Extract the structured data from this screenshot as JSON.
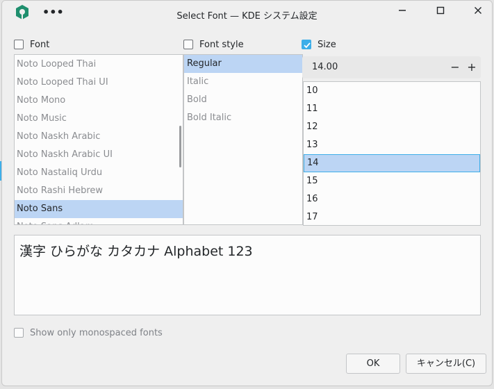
{
  "window": {
    "title": "Select Font — KDE システム設定",
    "menu_glyph": "•••",
    "minimize": "—",
    "maximize": "☐",
    "close": "✕"
  },
  "columns": {
    "font": {
      "label": "Font",
      "checked": false
    },
    "style": {
      "label": "Font style",
      "checked": false
    },
    "size": {
      "label": "Size",
      "checked": true
    }
  },
  "font_list": {
    "items": [
      "Noto Looped Thai",
      "Noto Looped Thai UI",
      "Noto Mono",
      "Noto Music",
      "Noto Naskh Arabic",
      "Noto Naskh Arabic UI",
      "Noto Nastaliq Urdu",
      "Noto Rashi Hebrew",
      "Noto Sans",
      "Noto Sans Adlam"
    ],
    "selected": "Noto Sans"
  },
  "style_list": {
    "items": [
      "Regular",
      "Italic",
      "Bold",
      "Bold Italic"
    ],
    "selected": "Regular"
  },
  "size": {
    "value": "14.00",
    "minus": "−",
    "plus": "+",
    "items": [
      "10",
      "11",
      "12",
      "13",
      "14",
      "15",
      "16",
      "17"
    ],
    "selected": "14"
  },
  "preview": {
    "text": "漢字 ひらがな カタカナ Alphabet 123"
  },
  "monospace": {
    "label": "Show only monospaced fonts",
    "checked": false
  },
  "buttons": {
    "ok": "OK",
    "cancel": "キャンセル(C)"
  },
  "colors": {
    "accent": "#3daee9",
    "selection": "#bcd5f4",
    "app_icon": "#1f8f6e"
  },
  "icons": {
    "app": "kde-system-settings-icon",
    "checkmark": "checkmark-icon"
  }
}
